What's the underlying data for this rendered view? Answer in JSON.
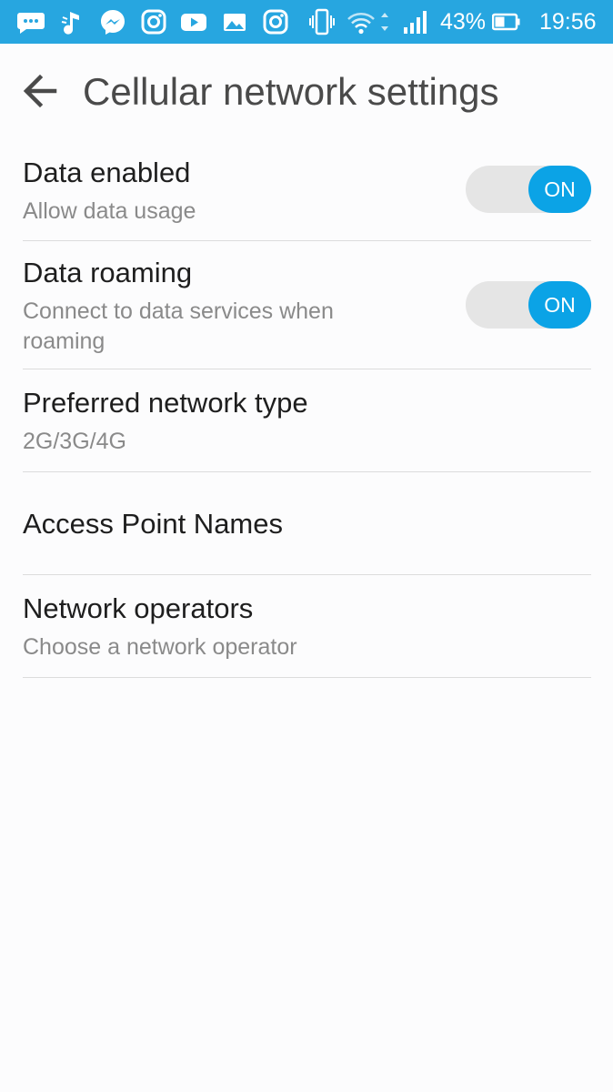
{
  "status_bar": {
    "battery_percent": "43%",
    "time": "19:56",
    "icons": [
      "chat-bubble-icon",
      "music-note-icon",
      "messenger-icon",
      "instagram-icon",
      "youtube-icon",
      "gallery-icon",
      "instagram-icon",
      "vibrate-icon",
      "wifi-icon",
      "signal-icon",
      "battery-icon"
    ],
    "color": "#27a6e0"
  },
  "header": {
    "title": "Cellular network settings",
    "back_icon": "back-arrow-icon"
  },
  "settings": [
    {
      "title": "Data enabled",
      "summary": "Allow data usage",
      "toggle": {
        "label": "ON",
        "state": "on"
      }
    },
    {
      "title": "Data roaming",
      "summary": "Connect to data services when roaming",
      "toggle": {
        "label": "ON",
        "state": "on"
      }
    },
    {
      "title": "Preferred network type",
      "summary": "2G/3G/4G"
    },
    {
      "title": "Access Point Names"
    },
    {
      "title": "Network operators",
      "summary": "Choose a network operator"
    }
  ],
  "colors": {
    "accent": "#0ba3e6",
    "toggle_track": "#e5e5e5",
    "title_text": "#1e1e1e",
    "summary_text": "#8a8a8a"
  }
}
